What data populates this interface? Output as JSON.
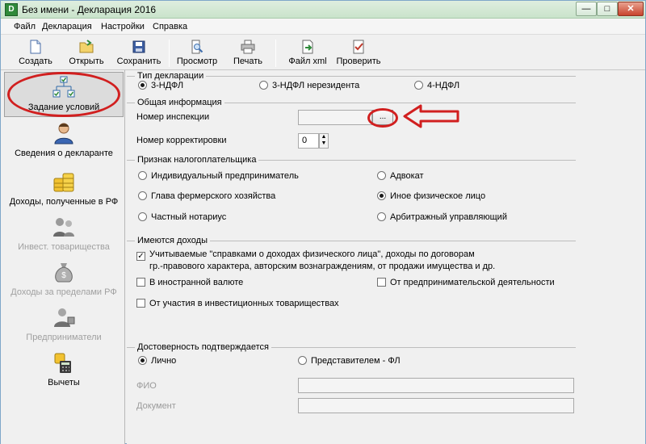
{
  "window": {
    "title": "Без имени - Декларация 2016",
    "app_icon_letter": "D",
    "controls": {
      "minimize": "—",
      "maximize": "□",
      "close": "✕"
    }
  },
  "menu": [
    "Файл",
    "Декларация",
    "Настройки",
    "Справка"
  ],
  "toolbar": {
    "create": "Создать",
    "open": "Открыть",
    "save": "Сохранить",
    "preview": "Просмотр",
    "print": "Печать",
    "xml": "Файл xml",
    "check": "Проверить"
  },
  "nav": {
    "items": [
      {
        "label": "Задание условий",
        "icon": "tree-checklist-icon",
        "active": true,
        "disabled": false
      },
      {
        "label": "Сведения о декларанте",
        "icon": "person-icon",
        "active": false,
        "disabled": false
      },
      {
        "label": "Доходы, полученные в РФ",
        "icon": "coins-icon",
        "active": false,
        "disabled": false
      },
      {
        "label": "Инвест. товарищества",
        "icon": "investors-icon",
        "active": false,
        "disabled": true
      },
      {
        "label": "Доходы за пределами РФ",
        "icon": "money-bag-icon",
        "active": false,
        "disabled": true
      },
      {
        "label": "Предприниматели",
        "icon": "businessman-icon",
        "active": false,
        "disabled": true
      },
      {
        "label": "Вычеты",
        "icon": "calculator-icon",
        "active": false,
        "disabled": false
      }
    ]
  },
  "declaration_type": {
    "title": "Тип декларации",
    "options": [
      "3-НДФЛ",
      "3-НДФЛ нерезидента",
      "4-НДФЛ"
    ],
    "selected": "3-НДФЛ"
  },
  "general_info": {
    "title": "Общая информация",
    "inspection_label": "Номер инспекции",
    "inspection_value": "",
    "browse_label": "...",
    "correction_label": "Номер корректировки",
    "correction_value": "0"
  },
  "taxpayer": {
    "title": "Признак налогоплательщика",
    "options": [
      "Индивидуальный предприниматель",
      "Адвокат",
      "Глава фермерского хозяйства",
      "Иное физическое лицо",
      "Частный нотариус",
      "Арбитражный управляющий"
    ],
    "selected": "Иное физическое лицо"
  },
  "income": {
    "title": "Имеются доходы",
    "options": [
      {
        "label": "Учитываемые \"справками о доходах физического лица\", доходы по договорам",
        "label2": "гр.-правового характера, авторским вознаграждениям, от продажи имущества и др.",
        "checked": true
      },
      {
        "label": "В иностранной валюте",
        "checked": false
      },
      {
        "label": "От предпринимательской деятельности",
        "checked": false
      },
      {
        "label": "От участия в инвестиционных товариществах",
        "checked": false
      }
    ]
  },
  "confirmation": {
    "title": "Достоверность подтверждается",
    "options": [
      "Лично",
      "Представителем - ФЛ"
    ],
    "selected": "Лично",
    "fio_label": "ФИО",
    "fio_value": "",
    "document_label": "Документ",
    "document_value": ""
  },
  "colors": {
    "annotation": "#d11f1f",
    "titlebar": "#d2e8d4"
  }
}
